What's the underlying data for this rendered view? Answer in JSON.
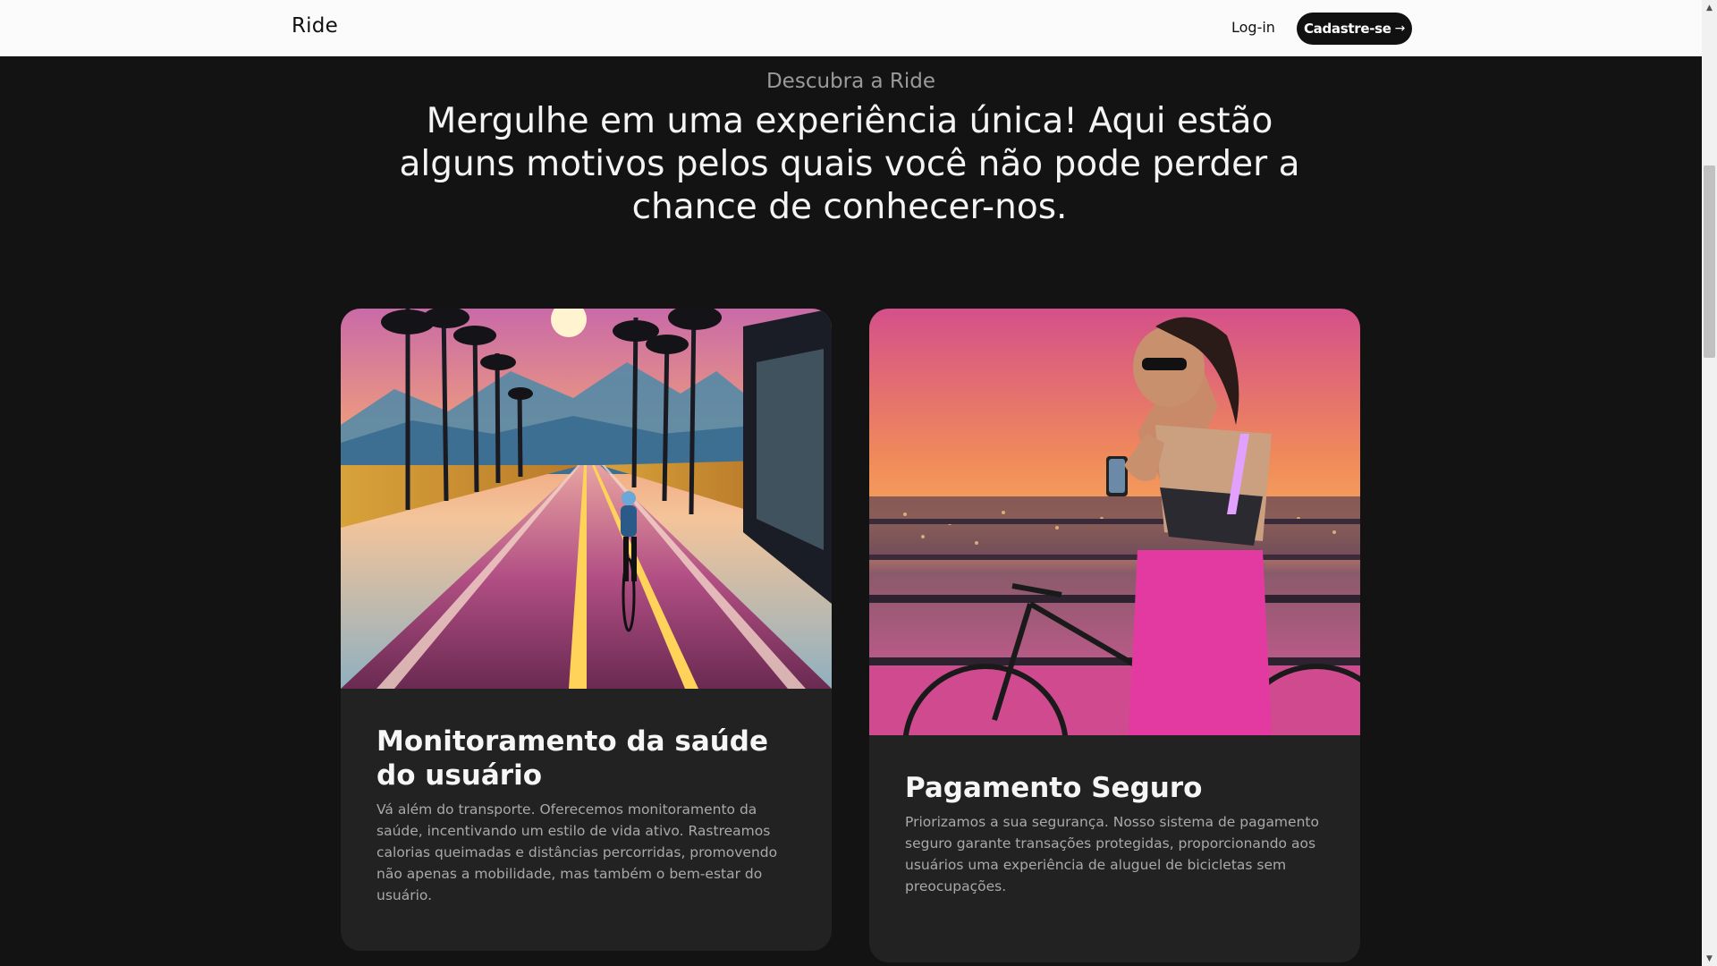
{
  "header": {
    "brand": "Ride",
    "login_label": "Log-in",
    "signup_label": "Cadastre-se",
    "signup_icon": "arrow-right-icon"
  },
  "hero": {
    "eyebrow": "Descubra a Ride",
    "headline": "Mergulhe em uma experiência única! Aqui estão alguns motivos pelos quais você não pode perder a chance de conhecer-nos."
  },
  "cards": [
    {
      "image": "cyclist-on-road-at-sunset",
      "title": "Monitoramento da saúde do usuário",
      "text": "Vá além do transporte. Oferecemos monitoramento da saúde, incentivando um estilo de vida ativo. Rastreamos calorias queimadas e distâncias percorridas, promovendo não apenas a mobilidade, mas também o bem-estar do usuário."
    },
    {
      "image": "woman-with-phone-and-bicycle",
      "title": "Pagamento Seguro",
      "text": "Priorizamos a sua segurança. Nosso sistema de pagamento seguro garante transações protegidas, proporcionando aos usuários uma experiência de aluguel de bicicletas sem preocupações."
    }
  ],
  "colors": {
    "background": "#131313",
    "card": "#222222",
    "navbar": "#fbfbfb"
  }
}
